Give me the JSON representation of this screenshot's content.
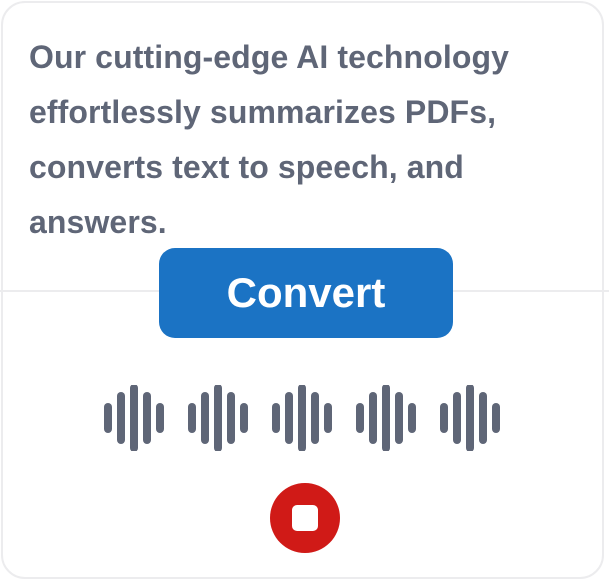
{
  "description": "Our cutting-edge AI technology effortlessly summarizes PDFs, converts text to speech, and answers.",
  "convert_label": "Convert",
  "icons": {
    "waveform": "audio-waveform-icon",
    "stop": "stop-icon"
  },
  "colors": {
    "accent": "#1b73c4",
    "text": "#5f6677",
    "waveform": "#5f6677",
    "stop": "#d01a17"
  }
}
